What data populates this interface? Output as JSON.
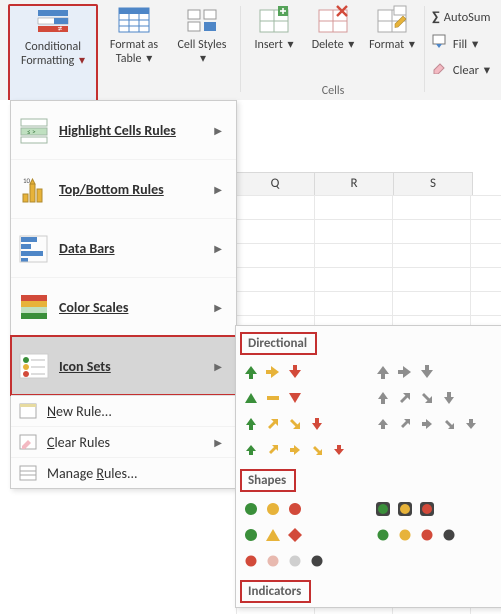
{
  "ribbon": {
    "styles_group": {
      "conditional_formatting": "Conditional Formatting",
      "format_as_table": "Format as Table",
      "cell_styles": "Cell Styles"
    },
    "cells_group": {
      "label": "Cells",
      "insert": "Insert",
      "delete": "Delete",
      "format": "Format"
    },
    "editing_group": {
      "autosum": "AutoSum",
      "fill": "Fill",
      "clear": "Clear"
    }
  },
  "columns": [
    "Q",
    "R",
    "S"
  ],
  "menu": {
    "highlight_cells": "Highlight Cells Rules",
    "top_bottom": "Top/Bottom Rules",
    "data_bars": "Data Bars",
    "color_scales": "Color Scales",
    "icon_sets": "Icon Sets",
    "new_rule": "New Rule...",
    "clear_rules": "Clear Rules",
    "manage_rules": "Manage Rules..."
  },
  "flyout": {
    "sections": {
      "directional": "Directional",
      "shapes": "Shapes",
      "indicators": "Indicators"
    }
  },
  "colors": {
    "green": "#3a8f3a",
    "yellow": "#e7b33a",
    "red": "#d24a3a",
    "gray": "#8e8e8e",
    "orange": "#e07a3a",
    "pink": "#e8b9af",
    "black": "#444444",
    "lgray": "#cfcfcf"
  }
}
